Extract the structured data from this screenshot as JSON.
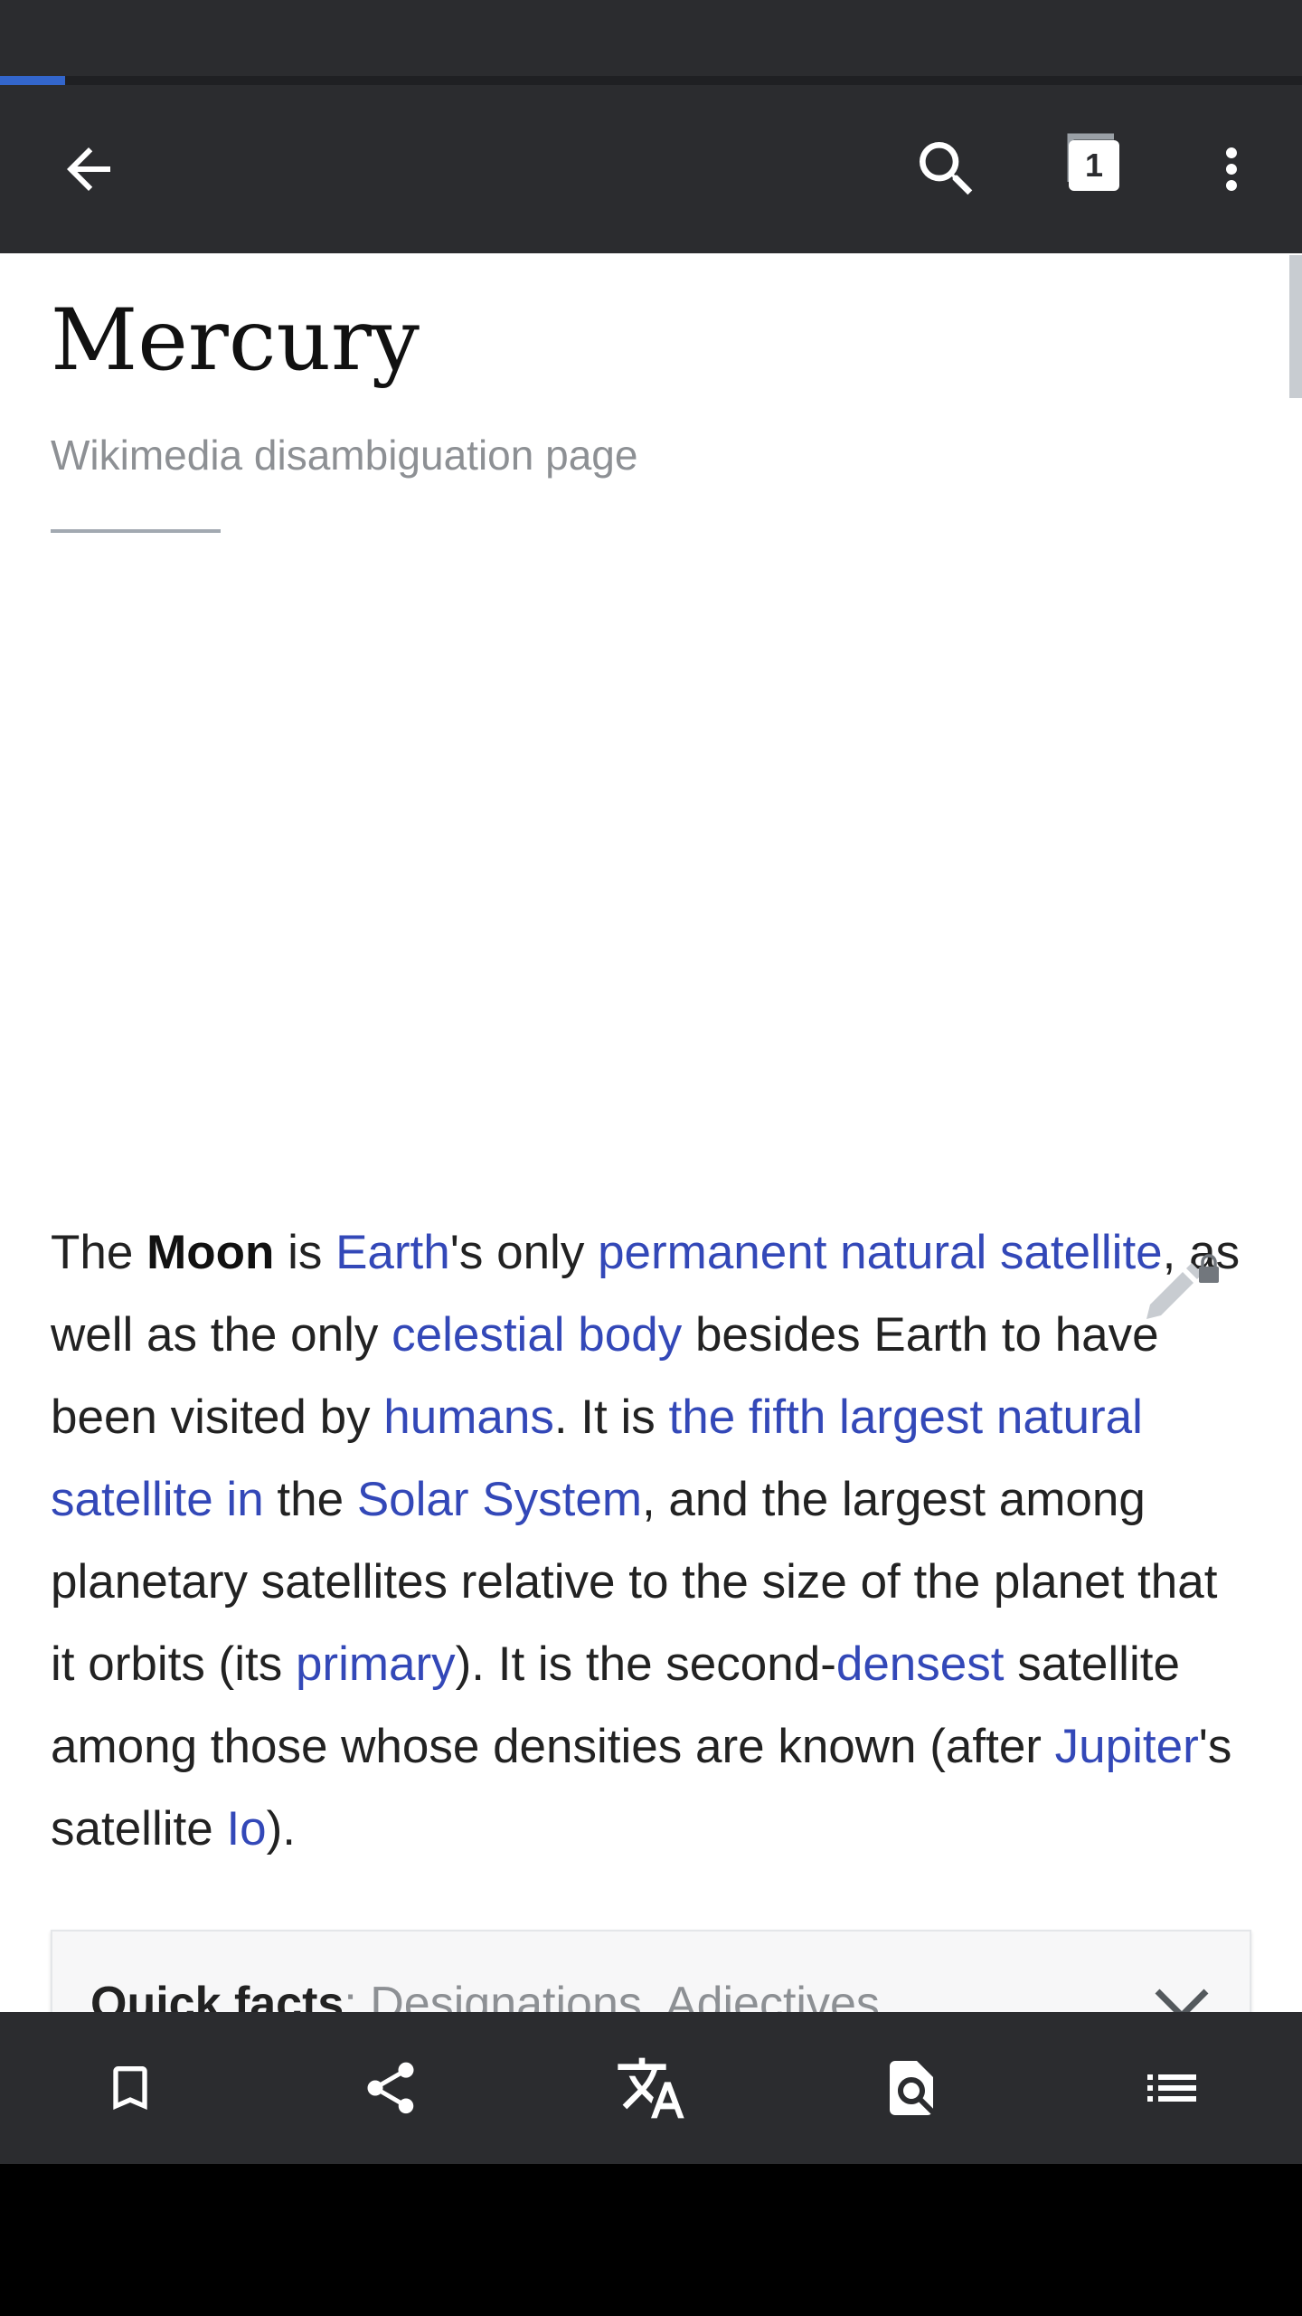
{
  "app": {
    "load_progress_percent": 5
  },
  "toolbar": {
    "back_icon": "arrow-left-icon",
    "search_icon": "search-icon",
    "tabs_icon": "tabs-icon",
    "tabs_count": "1",
    "overflow_icon": "more-vert-icon"
  },
  "article": {
    "title": "Mercury",
    "description": "Wikimedia disambiguation page",
    "edit_icon": "edit-lock-icon",
    "paragraph": {
      "t1": "The ",
      "bold_moon": "Moon",
      "t2": " is ",
      "link_earth": "Earth",
      "t3": "'s only ",
      "link_permanent_natural_satellite": "permanent natural satellite",
      "t4": ", as well as the only ",
      "link_celestial_body": "celestial body",
      "t5": " besides Earth to have been visited by ",
      "link_humans": "humans",
      "t6": ". It is ",
      "link_fifth_largest": "the fifth largest natural satellite in",
      "t7": " the ",
      "link_solar_system": "Solar System",
      "t8": ", and the largest among planetary satellites relative to the size of the planet that it orbits (its ",
      "link_primary": "primary",
      "t9": "). It is the second-",
      "link_densest": "densest",
      "t10": " satellite among those whose densities are known (after ",
      "link_jupiter": "Jupiter",
      "t11": "'s satellite ",
      "link_io": "Io",
      "t12": ")."
    },
    "quick_facts": {
      "label": "Quick facts",
      "separator": ": ",
      "items": "Designations, Adjectives",
      "chevron_icon": "chevron-down-icon"
    }
  },
  "bottom_bar": {
    "icons": [
      "bookmark-icon",
      "share-icon",
      "translate-icon",
      "find-in-page-icon",
      "contents-icon"
    ]
  },
  "colors": {
    "toolbar_bg": "#2b2c2f",
    "link": "#3348b8",
    "progress": "#3366cc",
    "description": "#8d9094"
  }
}
